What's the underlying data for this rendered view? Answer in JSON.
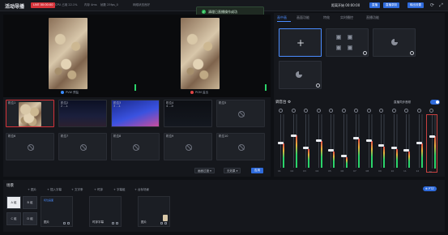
{
  "topbar": {
    "title": "活动导播",
    "live_badge": "LIVE 00:00:00",
    "stats": [
      "CPU 占用 22.1%",
      "内存 4ms",
      "帧数 25fps_0",
      "网络状态良好"
    ],
    "timer": "距离开始 00:00:00",
    "btn_start": "直播",
    "btn_record": "直播录制",
    "btn_output": "输出设置"
  },
  "toast": {
    "text": "清理已直播操作成功"
  },
  "preview": {
    "pvw_label": "PVW 预监",
    "pgm_label": "PGM 监出"
  },
  "sources": {
    "row1": [
      {
        "label": "机位1",
        "sub": ""
      },
      {
        "label": "机位2",
        "sub": "2 ...1"
      },
      {
        "label": "机位3",
        "sub": "3 ...1"
      },
      {
        "label": "机位4",
        "sub": "4 ...0"
      },
      {
        "label": "机位5",
        "sub": ""
      }
    ],
    "row2": [
      {
        "label": "机位6"
      },
      {
        "label": "机位7"
      },
      {
        "label": "机位8"
      },
      {
        "label": "机位9"
      },
      {
        "label": "机位10"
      }
    ],
    "select_transition": "画面过渡",
    "select_none": "无效果",
    "apply": "应用"
  },
  "right_tabs": [
    "画中画",
    "画面功能",
    "特效",
    "实时播控",
    "直播功能"
  ],
  "mixer": {
    "title": "调音台",
    "sync_label": "直播同步音频",
    "channels": [
      {
        "level": 0.45,
        "num": "01"
      },
      {
        "level": 0.6,
        "num": "02"
      },
      {
        "level": 0.35,
        "num": "03"
      },
      {
        "level": 0.5,
        "num": "04"
      },
      {
        "level": 0.3,
        "num": "05"
      },
      {
        "level": 0.2,
        "num": "06"
      },
      {
        "level": 0.55,
        "num": "07"
      },
      {
        "level": 0.5,
        "num": "08"
      },
      {
        "level": 0.4,
        "num": "09"
      },
      {
        "level": 0.35,
        "num": "10"
      },
      {
        "level": 0.3,
        "num": "11"
      },
      {
        "level": 0.45,
        "num": "12"
      },
      {
        "level": 0.6,
        "num": "M"
      }
    ]
  },
  "scene": {
    "title": "场景",
    "buttons": [
      "图片",
      "插入字幕",
      "文字条",
      "时钟",
      "字幕组",
      "台标场景"
    ],
    "ptz": "PTZ",
    "abcd": [
      "A 组",
      "B 组",
      "C 组",
      "D 组"
    ],
    "cards": [
      {
        "head": "机位画面",
        "name": "图片"
      },
      {
        "head": "",
        "name": "时钟字幕"
      },
      {
        "head": "",
        "name": "图片"
      }
    ]
  },
  "colors": {
    "accent": "#2f6bdc",
    "live": "#d6333a",
    "green": "#2bd46a"
  }
}
